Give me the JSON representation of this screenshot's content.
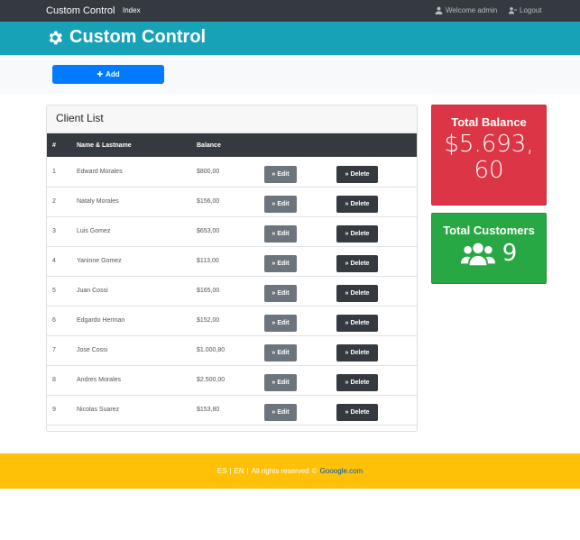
{
  "navbar": {
    "brand": "Custom Control",
    "index_link": "Index",
    "welcome": "Welcome admin",
    "logout": "Logout"
  },
  "header": {
    "title": "Custom Control",
    "icon": "gear-icon"
  },
  "actions": {
    "add_label": "Add"
  },
  "clients": {
    "title": "Client List",
    "columns": [
      "#",
      "Name & Lastname",
      "Balance"
    ],
    "edit_label": "Edit",
    "delete_label": "Delete",
    "rows": [
      {
        "num": "1",
        "name": "Edward Morales",
        "balance": "$800,00"
      },
      {
        "num": "2",
        "name": "Nataly Morales",
        "balance": "$156,00"
      },
      {
        "num": "3",
        "name": "Luis Gomez",
        "balance": "$653,00"
      },
      {
        "num": "4",
        "name": "Yaninne Gomez",
        "balance": "$113,00"
      },
      {
        "num": "5",
        "name": "Juan Cossi",
        "balance": "$165,00"
      },
      {
        "num": "6",
        "name": "Edgardo Herman",
        "balance": "$152,00"
      },
      {
        "num": "7",
        "name": "Jose Cossi",
        "balance": "$1.000,80"
      },
      {
        "num": "8",
        "name": "Andres Morales",
        "balance": "$2.500,00"
      },
      {
        "num": "9",
        "name": "Nicolas Suarez",
        "balance": "$153,80"
      }
    ]
  },
  "stats": {
    "balance_title": "Total Balance",
    "balance_value": "$5.693,60",
    "customers_title": "Total Customers",
    "customers_value": "9"
  },
  "footer": {
    "lang_es": "ES",
    "lang_en": "EN",
    "rights": "All rights reserved",
    "copyright": "©",
    "link": "Gooogle.com"
  },
  "colors": {
    "navbar": "#343a40",
    "header": "#17a2b8",
    "primary": "#007bff",
    "danger": "#dc3545",
    "success": "#28a745",
    "footer": "#ffc107"
  }
}
